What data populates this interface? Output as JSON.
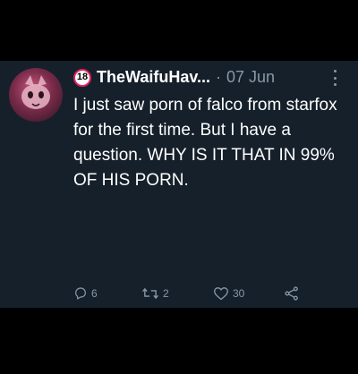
{
  "tweet": {
    "badge": "18",
    "display_name": "TheWaifuHav...",
    "separator": "·",
    "timestamp": "07 Jun",
    "text": "I just saw porn of falco from starfox for the first time. But I have a question. WHY IS IT THAT IN 99% OF HIS PORN."
  },
  "actions": {
    "replies": "6",
    "retweets": "2",
    "likes": "30"
  },
  "icons": {
    "more": "more-options-icon",
    "reply": "reply-icon",
    "retweet": "retweet-icon",
    "like": "heart-icon",
    "share": "share-icon"
  },
  "colors": {
    "background": "#000000",
    "card": "#15202b",
    "text": "#ffffff",
    "muted": "#8899a6",
    "badge_border": "#e0245e"
  }
}
